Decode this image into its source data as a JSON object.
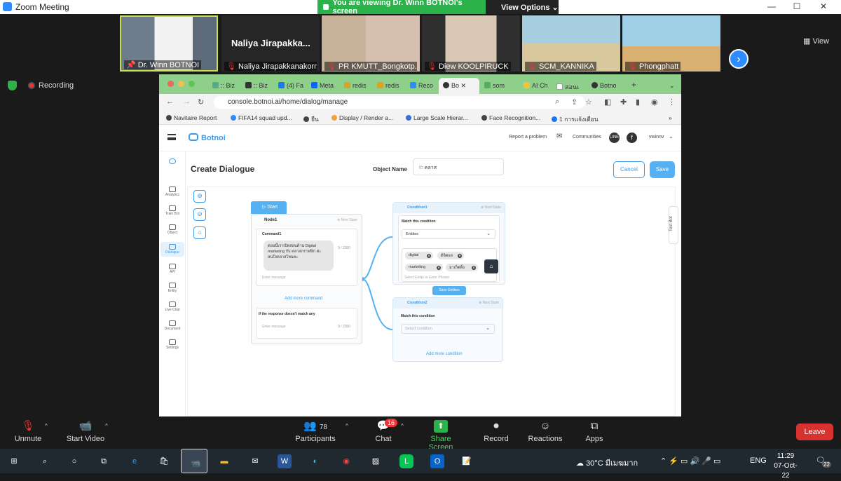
{
  "window": {
    "title": "Zoom Meeting",
    "minimize": "—",
    "maximize": "☐",
    "close": "✕"
  },
  "share_banner": {
    "text": "You are viewing Dr. Winn BOTNOI's screen",
    "options": "View Options ⌄"
  },
  "gallery": {
    "tiles": [
      {
        "name": "Dr. Winn BOTNOI",
        "muted": false,
        "pinned": true
      },
      {
        "name": "Naliya Jirapakkanakorn",
        "big_name": "Naliya  Jirapakka...",
        "muted": true
      },
      {
        "name": "PR KMUTT_Bongkotp...",
        "muted": true
      },
      {
        "name": "Diew KOOLPIRUCK",
        "muted": true
      },
      {
        "name": "SCM_KANNIKA",
        "muted": true
      },
      {
        "name": "Phongphatt",
        "muted": true
      }
    ],
    "view_label": "View"
  },
  "recording": "Recording",
  "browser": {
    "tabs": [
      ":: Biz",
      ":: Biz",
      "(4) Fa",
      "Meta",
      "redis",
      "redis",
      "Reco",
      "Bo",
      "som",
      "AI Ch",
      "สอนเ",
      "Botno"
    ],
    "url": "console.botnoi.ai/home/dialog/manage",
    "bookmarks": [
      "Navitaire Report",
      "FIFA14 squad upd...",
      "ยืน",
      "Display / Render a...",
      "Large Scale Hierar...",
      "Face Recognition...",
      "1 การแจ้งเตือน"
    ]
  },
  "app": {
    "brand": "Botnoi",
    "report": "Report a problem",
    "communities": "Communities",
    "user": "vwinnv",
    "line": "LINE",
    "sidebar": [
      "Analytics",
      "Train Bot",
      "Object",
      "Dialogue",
      "API",
      "Entity",
      "Live Chat",
      "Document",
      "Settings"
    ],
    "page_title": "Create Dialogue",
    "object_name_label": "Object Name",
    "object_name_prefix": "th",
    "object_name_value": "คลาส",
    "cancel": "Cancel",
    "save": "Save",
    "test_bot": "Test Bot",
    "start": "Start",
    "node": {
      "title": "Node1",
      "next_state": "Next State",
      "command_title": "Command1",
      "message": "ตอนนี้เราเปิดสอนด้าน Digital marketing กับ คลาสกราฟฟิก ค่ะ สนใจคลาสไหนคะ",
      "counter": "0 / 2000",
      "enter_message": "Enter message",
      "add_command": "Add more command",
      "no_match": "If the response doesn't match any",
      "no_match_placeholder": "Enter message",
      "no_match_counter": "0 / 2000"
    },
    "condition1": {
      "title": "Condition1",
      "next_state": "Next State",
      "match": "Match this condition",
      "select": "Entities",
      "tags": [
        "digital",
        "ดิจิตอล",
        "marketing",
        "มาเก็ตติ้ง"
      ],
      "entity_placeholder": "Select Entity or Enter Phrase",
      "save_entities": "Save Entities"
    },
    "condition2": {
      "title": "Condition2",
      "next_state": "Next State",
      "match": "Match this condition",
      "select": "Select condition",
      "add_more": "Add more condition"
    }
  },
  "toolbar": {
    "unmute": "Unmute",
    "start_video": "Start Video",
    "participants": "Participants",
    "participants_count": "78",
    "chat": "Chat",
    "chat_badge": "16",
    "share": "Share Screen",
    "record": "Record",
    "reactions": "Reactions",
    "apps": "Apps",
    "leave": "Leave"
  },
  "taskbar": {
    "weather": "30°C  มีเมฆมาก",
    "lang": "ENG",
    "time": "11:29",
    "date": "07-Oct-22",
    "notifications": "22"
  },
  "colors": {
    "accent": "#2d8cff",
    "share_green": "#2cb24a",
    "botnoi_blue": "#3b9be8",
    "leave_red": "#d7322f"
  }
}
